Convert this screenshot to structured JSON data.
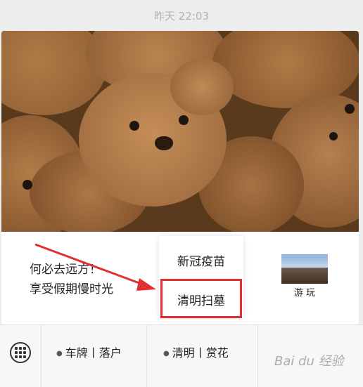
{
  "timestamp": "昨天 22:03",
  "promo": {
    "line1": "何必去远方！",
    "line2": "享受假期慢时光"
  },
  "thumbnail_label": "游 玩",
  "popup": {
    "items": [
      "新冠疫苗",
      "清明扫墓"
    ]
  },
  "bottom_menu": {
    "item1": "车牌丨落户",
    "item2": "清明丨赏花"
  },
  "watermark": "Bai du 经验",
  "colors": {
    "highlight": "#e03030",
    "arrow": "#e03030"
  }
}
